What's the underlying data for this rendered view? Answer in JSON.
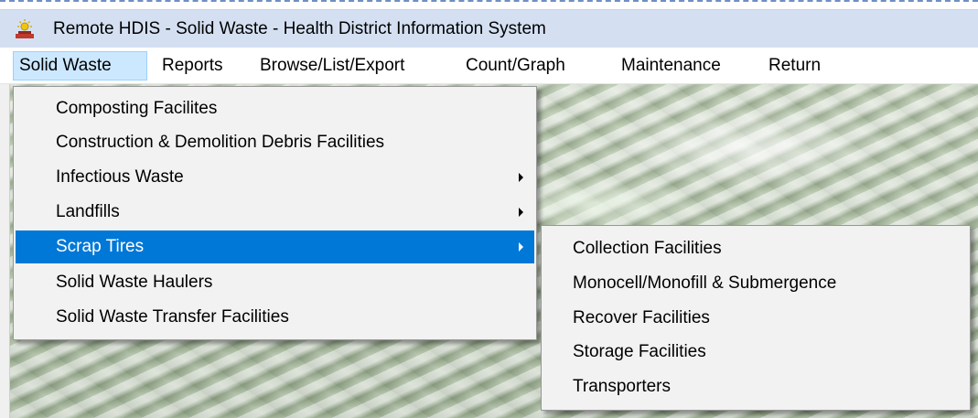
{
  "window": {
    "title": "Remote HDIS - Solid Waste - Health District Information System",
    "icon": "app-sun-icon"
  },
  "menubar": {
    "items": [
      {
        "label": "Solid Waste",
        "active": true
      },
      {
        "label": "Reports"
      },
      {
        "label": "Browse/List/Export"
      },
      {
        "label": "Count/Graph"
      },
      {
        "label": "Maintenance"
      },
      {
        "label": "Return"
      }
    ]
  },
  "solid_waste_menu": {
    "items": [
      {
        "label": "Composting Facilites",
        "has_submenu": false
      },
      {
        "label": "Construction & Demolition Debris Facilities",
        "has_submenu": false
      },
      {
        "label": "Infectious Waste",
        "has_submenu": true
      },
      {
        "label": "Landfills",
        "has_submenu": true
      },
      {
        "label": "Scrap Tires",
        "has_submenu": true,
        "highlighted": true
      },
      {
        "label": "Solid Waste Haulers",
        "has_submenu": false
      },
      {
        "label": "Solid Waste Transfer Facilities",
        "has_submenu": false
      }
    ]
  },
  "scrap_tires_submenu": {
    "items": [
      {
        "label": "Collection Facilities"
      },
      {
        "label": "Monocell/Monofill & Submergence"
      },
      {
        "label": "Recover Facilities"
      },
      {
        "label": "Storage Facilities"
      },
      {
        "label": "Transporters"
      }
    ]
  },
  "colors": {
    "titlebar": "#d4e0f2",
    "menu_highlight": "#0078d7",
    "menubar_active": "#cce8ff"
  }
}
